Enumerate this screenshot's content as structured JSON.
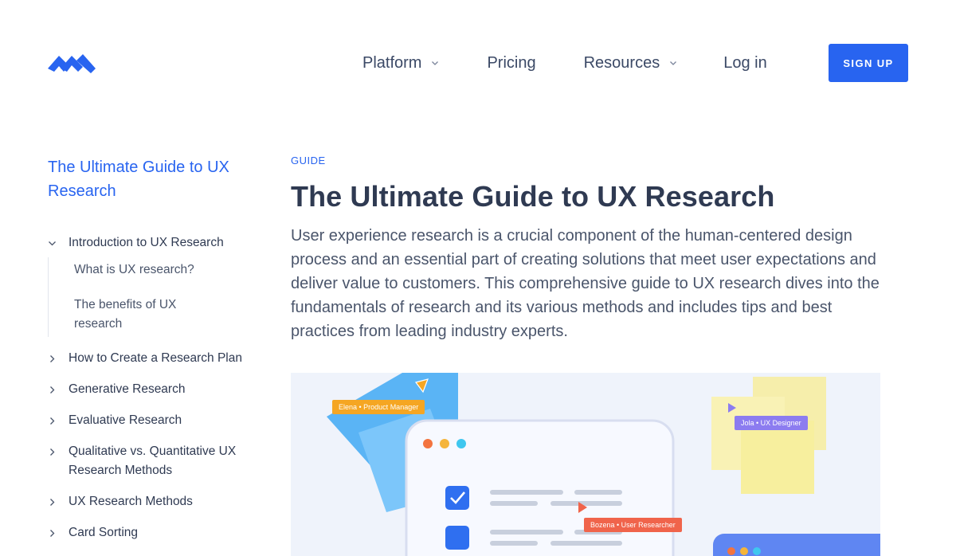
{
  "header": {
    "logo_name": "brand-logo",
    "nav": {
      "platform": "Platform",
      "pricing": "Pricing",
      "resources": "Resources",
      "login": "Log in"
    },
    "signup_label": "SIGN UP"
  },
  "sidebar": {
    "title": "The Ultimate Guide to UX Research",
    "items": [
      {
        "label": "Introduction to UX Research",
        "expanded": true,
        "children": [
          "What is UX research?",
          "The benefits of UX research"
        ]
      },
      {
        "label": "How to Create a Research Plan"
      },
      {
        "label": "Generative Research"
      },
      {
        "label": "Evaluative Research"
      },
      {
        "label": "Qualitative vs. Quantitative UX Research Methods"
      },
      {
        "label": "UX Research Methods"
      },
      {
        "label": "Card Sorting"
      }
    ]
  },
  "main": {
    "eyebrow": "GUIDE",
    "title": "The Ultimate Guide to UX Research",
    "intro": "User experience research is a crucial component of the human-centered design process and an essential part of creating solutions that meet user expectations and deliver value to customers. This comprehensive guide to UX research dives into the fundamentals of research and its various methods and includes tips and best practices from leading industry experts."
  },
  "illustration": {
    "tag_elena": "Elena • Product Manager",
    "tag_jola": "Jola • UX Designer",
    "tag_bozena": "Bozena • User Researcher"
  },
  "colors": {
    "accent": "#2864f0",
    "text": "#2f3a52",
    "orange": "#f5a623",
    "coral": "#f0644b",
    "purple": "#8c7cf0"
  }
}
